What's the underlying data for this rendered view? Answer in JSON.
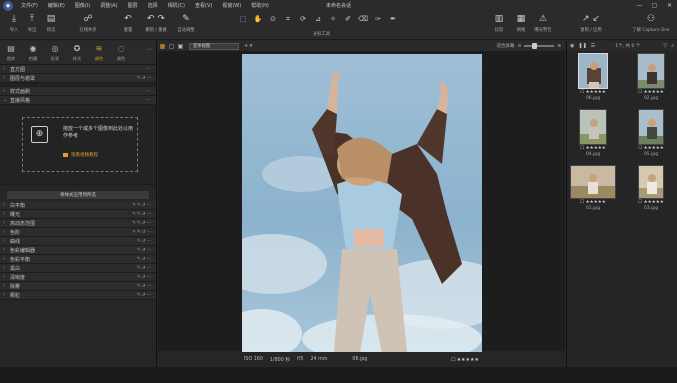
{
  "app": {
    "title": "未命名会话"
  },
  "menu": [
    "文件(F)",
    "编辑(E)",
    "图像(I)",
    "调整(A)",
    "图层",
    "选择",
    "相机(C)",
    "查看(V)",
    "视窗(W)",
    "帮助(H)"
  ],
  "window_controls": [
    "—",
    "▢",
    "✕"
  ],
  "toolbar": {
    "left": [
      {
        "label": "导入",
        "icon": "import-icon"
      },
      {
        "label": "导出",
        "icon": "export-icon"
      },
      {
        "label": "转迅",
        "icon": "process-icon"
      },
      {
        "label": "在线共享",
        "icon": "share-icon"
      },
      {
        "label": "重置",
        "icon": "reset-icon"
      },
      {
        "label": "撤销 / 重做",
        "icon": "undo-redo-icon"
      },
      {
        "label": "自动调整",
        "icon": "auto-adjust-icon"
      }
    ],
    "center_label": "光标工具",
    "right": [
      {
        "label": "比较",
        "icon": "compare-icon"
      },
      {
        "label": "网格",
        "icon": "grid-icon"
      },
      {
        "label": "曝光警告",
        "icon": "warning-icon"
      },
      {
        "label": "复制 / 应用",
        "icon": "copy-apply-icon"
      },
      {
        "label": "了解 Capture One",
        "icon": "learn-icon"
      }
    ]
  },
  "tool_tabs": [
    {
      "label": "图库"
    },
    {
      "label": "拍摄"
    },
    {
      "label": "形状"
    },
    {
      "label": "样式"
    },
    {
      "label": "调色",
      "active": true
    },
    {
      "label": "调色"
    }
  ],
  "left_panel": {
    "top_rows": [
      "直方图",
      "图层与遮罩"
    ],
    "mid_rows": [
      "样式画刷",
      "直接风格"
    ],
    "drop_text": "拖放一个或多个图像到此处以用作参考",
    "learn_link": "观看视频教程",
    "apply_button": "将样式应用到所选",
    "adjust_rows": [
      "白平衡",
      "曝光",
      "高动态范围",
      "色阶",
      "曲线",
      "色彩编辑器",
      "色彩平衡",
      "黑白",
      "清晰度",
      "除雾",
      "颗粒"
    ]
  },
  "viewer": {
    "view_select": "变体视图",
    "plus": "+ ▾",
    "zoom_label": "适合屏幕",
    "exif": {
      "iso": "ISO 160",
      "shutter": "1/800 秒",
      "aperture": "f/5",
      "focal": "24 mm",
      "file": "06.jpg"
    },
    "rating": "★★★★★"
  },
  "browser": {
    "count": "1个, 共 6 个",
    "thumbs": [
      {
        "file": "06.jpg",
        "rating": "★★★★★",
        "selected": true
      },
      {
        "file": "02.jpg",
        "rating": "★★★★★",
        "selected": false
      },
      {
        "file": "04.jpg",
        "rating": "★★★★★",
        "selected": false
      },
      {
        "file": "05.jpg",
        "rating": "★★★★★",
        "selected": false
      },
      {
        "file": "01.jpg",
        "rating": "★★★★★",
        "selected": false
      },
      {
        "file": "03.jpg",
        "rating": "★★★★★",
        "selected": false
      }
    ]
  },
  "colors": {
    "accent": "#e59a2f",
    "panel": "#262626",
    "sky": "#8fb6d1"
  }
}
